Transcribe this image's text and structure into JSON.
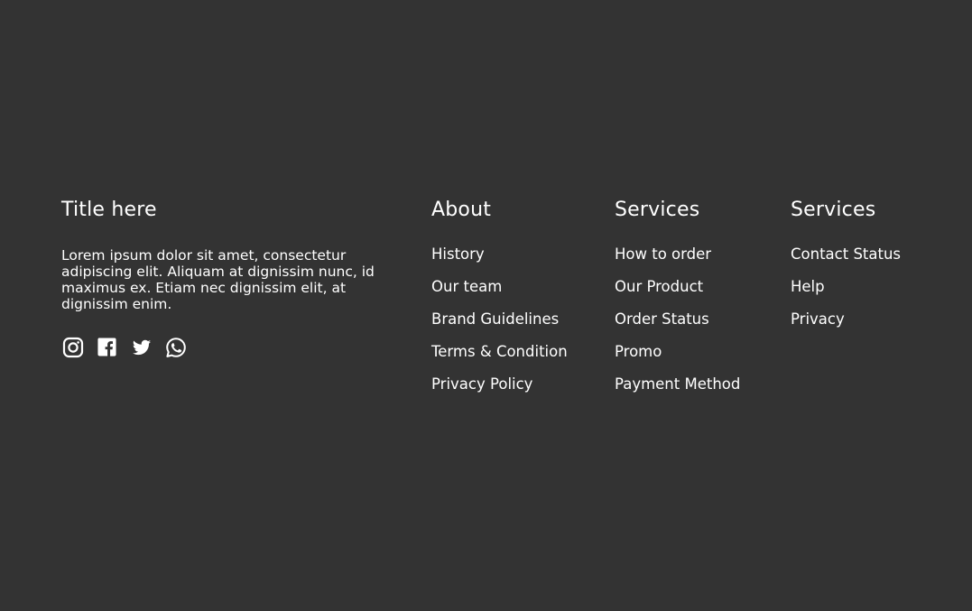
{
  "colors": {
    "background": "#333333",
    "text": "#ffffff"
  },
  "brand": {
    "title": "Title here",
    "description": "Lorem ipsum dolor sit amet, consectetur adipiscing elit. Aliquam at dignissim nunc, id maximus ex. Etiam nec dignissim elit, at dignissim enim.",
    "social": [
      {
        "icon": "instagram-icon"
      },
      {
        "icon": "facebook-icon"
      },
      {
        "icon": "twitter-icon"
      },
      {
        "icon": "whatsapp-icon"
      }
    ]
  },
  "about": {
    "title": "About",
    "links": [
      "History",
      "Our team",
      "Brand Guidelines",
      "Terms & Condition",
      "Privacy Policy"
    ]
  },
  "services": {
    "title": "Services",
    "links": [
      "How to order",
      "Our Product",
      "Order Status",
      "Promo",
      "Payment Method"
    ]
  },
  "services_2": {
    "title": "Services",
    "links": [
      "Contact Status",
      "Help",
      "Privacy"
    ]
  }
}
